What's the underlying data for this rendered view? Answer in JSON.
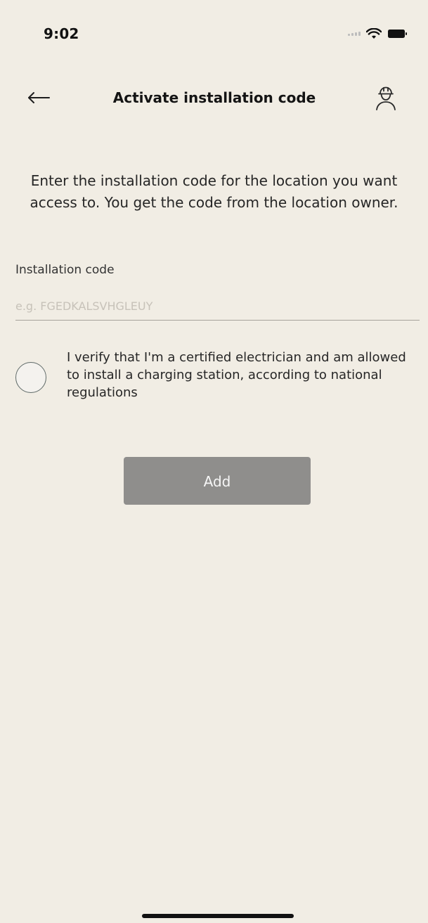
{
  "status_bar": {
    "time": "9:02",
    "signal_icon": "cellular-signal-icon",
    "wifi_icon": "wifi-icon",
    "battery_icon": "battery-icon"
  },
  "header": {
    "back_icon": "arrow-left-icon",
    "title": "Activate installation code",
    "profile_icon": "worker-profile-icon"
  },
  "intro": {
    "text": "Enter the installation code for the location you want access to. You get the code from the location owner."
  },
  "installation_code": {
    "label": "Installation code",
    "value": "",
    "placeholder": "e.g. FGEDKALSVHGLEUY"
  },
  "verification": {
    "text": "I verify that I'm a certified electrician and am allowed to install a charging station, according to national regulations",
    "checked": false
  },
  "actions": {
    "add_label": "Add"
  },
  "colors": {
    "background": "#f1ede4",
    "button_background": "#8f8e8c",
    "button_text": "#f6f6f6",
    "divider": "#a7a39b",
    "text": "#262626"
  }
}
